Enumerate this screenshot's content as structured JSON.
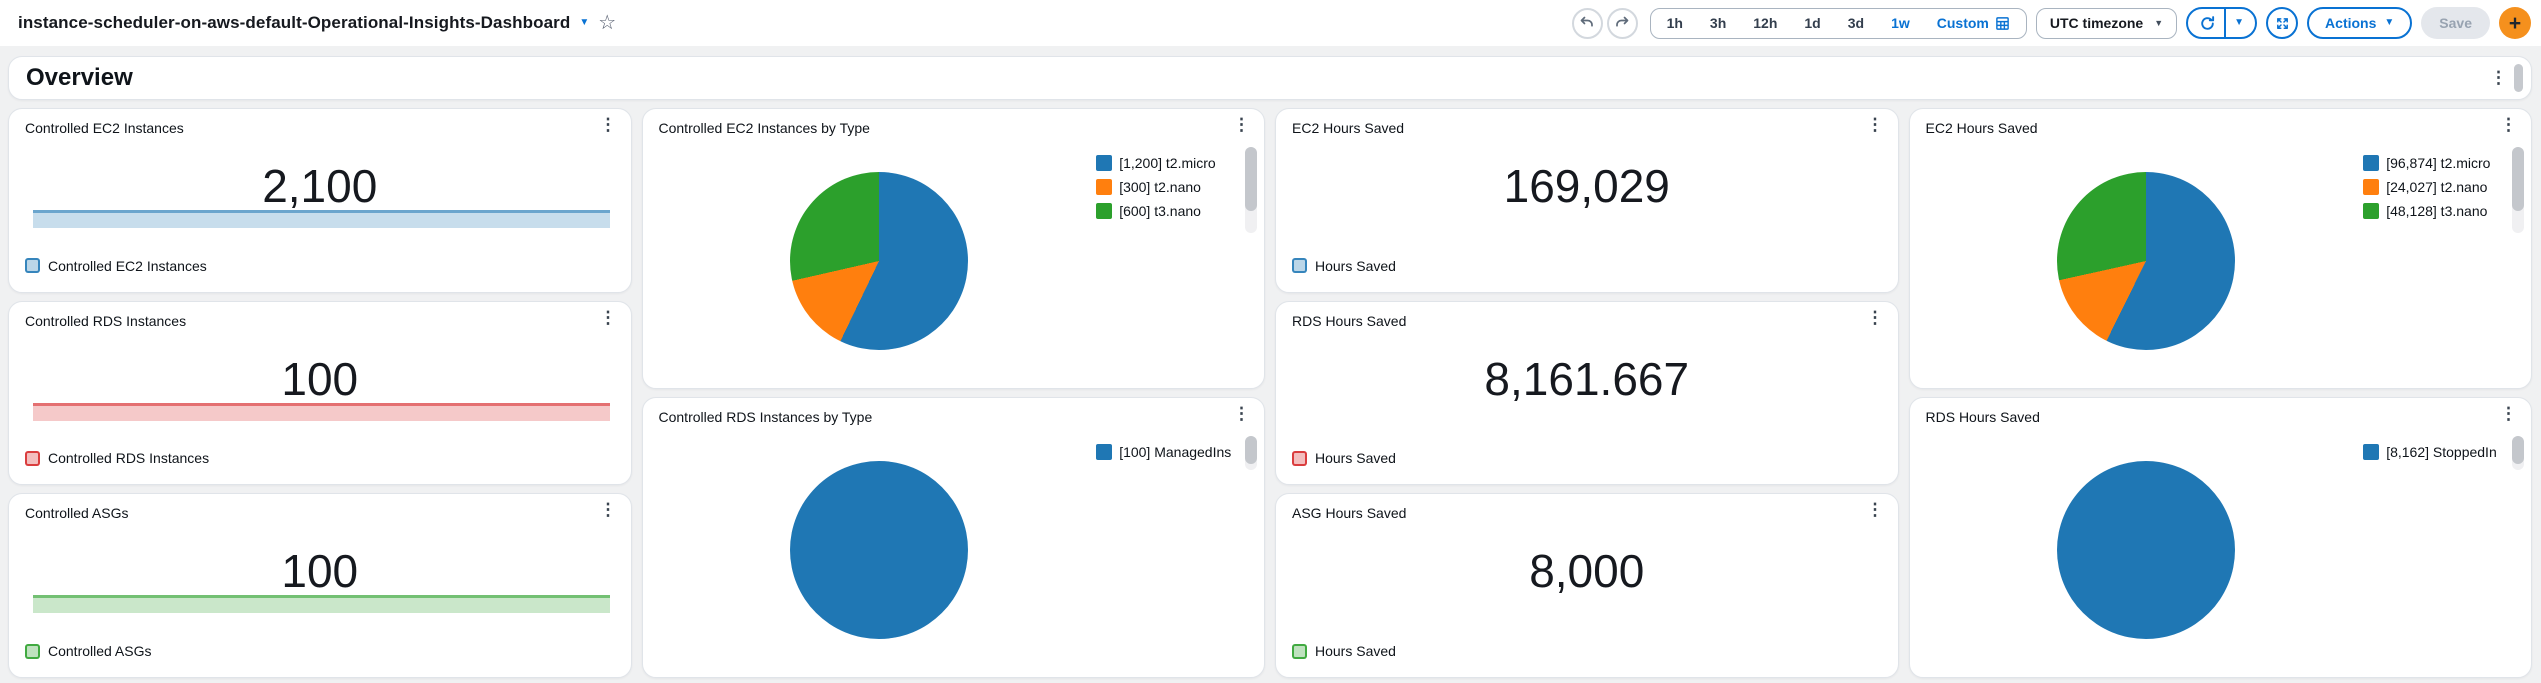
{
  "header": {
    "title": "instance-scheduler-on-aws-default-Operational-Insights-Dashboard",
    "time_ranges": {
      "options": [
        "1h",
        "3h",
        "12h",
        "1d",
        "3d",
        "1w"
      ],
      "selected": "1w",
      "custom_label": "Custom"
    },
    "timezone_label": "UTC timezone",
    "actions_label": "Actions",
    "save_label": "Save",
    "add_label": "+"
  },
  "icons": {
    "menu": "⋮",
    "caret_down": "▼",
    "star": "☆"
  },
  "colors": {
    "accent": "#0972d3",
    "add_button": "#f5901d",
    "series": {
      "blue": "#1f77b4",
      "orange": "#ff7f0e",
      "green": "#2ca02c",
      "red": "#d62728"
    }
  },
  "section": {
    "title": "Overview"
  },
  "widgets": {
    "controlled_ec2": {
      "title": "Controlled EC2 Instances",
      "value": "2,100",
      "legend": "Controlled EC2 Instances",
      "series": "blue"
    },
    "controlled_rds": {
      "title": "Controlled RDS Instances",
      "value": "100",
      "legend": "Controlled RDS Instances",
      "series": "red"
    },
    "controlled_asg": {
      "title": "Controlled ASGs",
      "value": "100",
      "legend": "Controlled ASGs",
      "series": "green"
    },
    "ec2_hours": {
      "title": "EC2 Hours Saved",
      "value": "169,029",
      "legend": "Hours Saved",
      "series": "blue"
    },
    "rds_hours": {
      "title": "RDS Hours Saved",
      "value": "8,161.667",
      "legend": "Hours Saved",
      "series": "red"
    },
    "asg_hours": {
      "title": "ASG Hours Saved",
      "value": "8,000",
      "legend": "Hours Saved",
      "series": "green"
    },
    "ec2_by_type_pie": {
      "title": "Controlled EC2 Instances by Type",
      "slices": [
        {
          "label": "[1,200] t2.micro",
          "value": 1200,
          "series": "blue"
        },
        {
          "label": "[300] t2.nano",
          "value": 300,
          "series": "orange"
        },
        {
          "label": "[600] t3.nano",
          "value": 600,
          "series": "green"
        }
      ]
    },
    "rds_by_type_pie": {
      "title": "Controlled RDS Instances by Type",
      "slices": [
        {
          "label": "[100] ManagedIns",
          "value": 100,
          "series": "blue"
        }
      ]
    },
    "ec2_hours_pie": {
      "title": "EC2 Hours Saved",
      "slices": [
        {
          "label": "[96,874] t2.micro",
          "value": 96874,
          "series": "blue"
        },
        {
          "label": "[24,027] t2.nano",
          "value": 24027,
          "series": "orange"
        },
        {
          "label": "[48,128] t3.nano",
          "value": 48128,
          "series": "green"
        }
      ]
    },
    "rds_hours_pie": {
      "title": "RDS Hours Saved",
      "slices": [
        {
          "label": "[8,162] StoppedIn",
          "value": 8162,
          "series": "blue"
        }
      ]
    }
  },
  "chart_data": [
    {
      "type": "table",
      "title": "Controlled EC2 Instances",
      "value": 2100,
      "legend": "Controlled EC2 Instances"
    },
    {
      "type": "table",
      "title": "Controlled RDS Instances",
      "value": 100,
      "legend": "Controlled RDS Instances"
    },
    {
      "type": "table",
      "title": "Controlled ASGs",
      "value": 100,
      "legend": "Controlled ASGs"
    },
    {
      "type": "table",
      "title": "EC2 Hours Saved",
      "value": 169029,
      "legend": "Hours Saved"
    },
    {
      "type": "table",
      "title": "RDS Hours Saved",
      "value": 8161.667,
      "legend": "Hours Saved"
    },
    {
      "type": "table",
      "title": "ASG Hours Saved",
      "value": 8000,
      "legend": "Hours Saved"
    },
    {
      "type": "pie",
      "title": "Controlled EC2 Instances by Type",
      "categories": [
        "t2.micro",
        "t2.nano",
        "t3.nano"
      ],
      "values": [
        1200,
        300,
        600
      ],
      "legend_entries": [
        "[1,200] t2.micro",
        "[300] t2.nano",
        "[600] t3.nano"
      ],
      "legend_position": "right"
    },
    {
      "type": "pie",
      "title": "Controlled RDS Instances by Type",
      "categories": [
        "ManagedIns"
      ],
      "values": [
        100
      ],
      "legend_entries": [
        "[100] ManagedIns"
      ],
      "legend_position": "right"
    },
    {
      "type": "pie",
      "title": "EC2 Hours Saved",
      "categories": [
        "t2.micro",
        "t2.nano",
        "t3.nano"
      ],
      "values": [
        96874,
        24027,
        48128
      ],
      "legend_entries": [
        "[96,874] t2.micro",
        "[24,027] t2.nano",
        "[48,128] t3.nano"
      ],
      "legend_position": "right"
    },
    {
      "type": "pie",
      "title": "RDS Hours Saved",
      "categories": [
        "StoppedIn"
      ],
      "values": [
        8162
      ],
      "legend_entries": [
        "[8,162] StoppedIn"
      ],
      "legend_position": "right"
    }
  ]
}
